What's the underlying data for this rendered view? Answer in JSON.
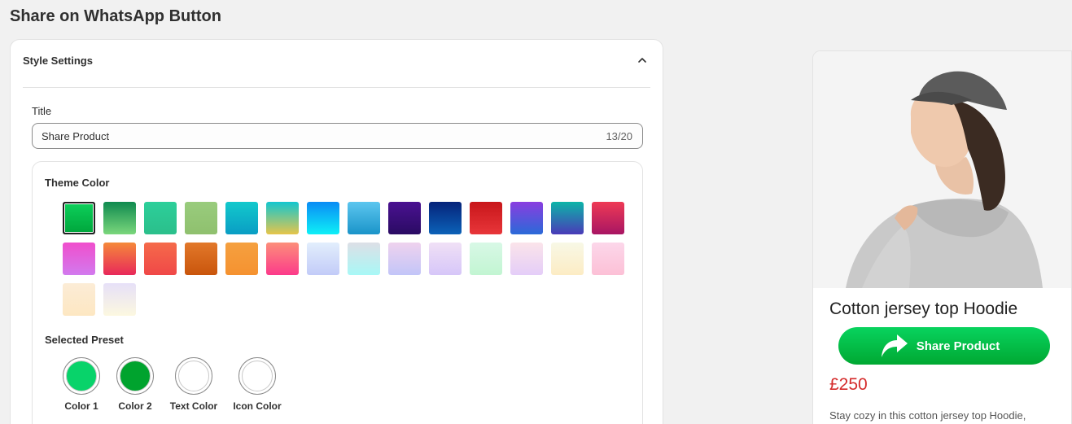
{
  "page": {
    "title": "Share on WhatsApp Button"
  },
  "style_settings": {
    "heading": "Style Settings",
    "title_label": "Title",
    "title_value": "Share Product",
    "char_count": "13/20"
  },
  "theme": {
    "label": "Theme Color",
    "swatches": [
      "linear-gradient(180deg,#0ccf5a,#00a63c)",
      "linear-gradient(180deg,#0f8a4f,#7bd77c)",
      "linear-gradient(180deg,#2ccf9a,#2bbf8b)",
      "linear-gradient(180deg,#99cc7d,#8fc06e)",
      "linear-gradient(180deg,#12c9cc,#0a9dc4)",
      "linear-gradient(180deg,#12c6cf,#e6c54a)",
      "linear-gradient(180deg,#0a8cf5,#0ef0f7)",
      "linear-gradient(180deg,#5cc6ef,#1a94c9)",
      "linear-gradient(180deg,#4a1191,#2a0b63)",
      "linear-gradient(180deg,#05237a,#0c62b8)",
      "linear-gradient(180deg,#c8161a,#e8363a)",
      "linear-gradient(180deg,#8a3de0,#2a6ad8)",
      "linear-gradient(180deg,#0cb5a8,#4a3ab8)",
      "linear-gradient(180deg,#ee3a55,#a81563)",
      "linear-gradient(180deg,#f04ecc,#d27aee)",
      "linear-gradient(180deg,#f5893a,#e8285a)",
      "linear-gradient(180deg,#f56a4a,#f04848)",
      "linear-gradient(180deg,#e2782a,#c9550c)",
      "linear-gradient(180deg,#f5a040,#f59230)",
      "linear-gradient(180deg,#fc8e7a,#fc3a8a)",
      "linear-gradient(180deg,#e2eefc,#c2cbf8)",
      "linear-gradient(180deg,#dddfe6,#a8f8f6)",
      "linear-gradient(180deg,#efd2ee,#c2c5f8)",
      "linear-gradient(180deg,#f0e0f6,#d6c6f8)",
      "linear-gradient(180deg,#d8f8e6,#c2f5d2)",
      "linear-gradient(180deg,#fbe4ea,#e4cdf8)",
      "linear-gradient(180deg,#f8f8e6,#fcecc4)",
      "linear-gradient(180deg,#fcd7ea,#fcc0d6)",
      "linear-gradient(180deg,#fcecd6,#fde7c2)",
      "linear-gradient(180deg,#e6e0f8,#fcf8e0)"
    ],
    "selected_index": 0
  },
  "preset": {
    "label": "Selected Preset",
    "items": [
      {
        "label": "Color 1",
        "color": "#08d36a"
      },
      {
        "label": "Color 2",
        "color": "#00a32e"
      },
      {
        "label": "Text Color",
        "color": "#ffffff"
      },
      {
        "label": "Icon Color",
        "color": "#ffffff"
      }
    ]
  },
  "preview": {
    "product_name": "Cotton jersey top Hoodie",
    "button_label": "Share Product",
    "price": "£250",
    "description": "Stay cozy in this cotton jersey top Hoodie,"
  }
}
